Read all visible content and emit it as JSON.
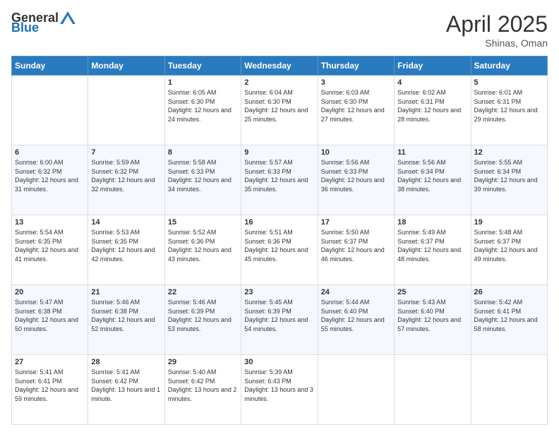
{
  "header": {
    "logo_general": "General",
    "logo_blue": "Blue",
    "title": "April 2025",
    "location": "Shinas, Oman"
  },
  "days_of_week": [
    "Sunday",
    "Monday",
    "Tuesday",
    "Wednesday",
    "Thursday",
    "Friday",
    "Saturday"
  ],
  "weeks": [
    [
      {
        "day": "",
        "sunrise": "",
        "sunset": "",
        "daylight": ""
      },
      {
        "day": "",
        "sunrise": "",
        "sunset": "",
        "daylight": ""
      },
      {
        "day": "1",
        "sunrise": "Sunrise: 6:05 AM",
        "sunset": "Sunset: 6:30 PM",
        "daylight": "Daylight: 12 hours and 24 minutes."
      },
      {
        "day": "2",
        "sunrise": "Sunrise: 6:04 AM",
        "sunset": "Sunset: 6:30 PM",
        "daylight": "Daylight: 12 hours and 25 minutes."
      },
      {
        "day": "3",
        "sunrise": "Sunrise: 6:03 AM",
        "sunset": "Sunset: 6:30 PM",
        "daylight": "Daylight: 12 hours and 27 minutes."
      },
      {
        "day": "4",
        "sunrise": "Sunrise: 6:02 AM",
        "sunset": "Sunset: 6:31 PM",
        "daylight": "Daylight: 12 hours and 28 minutes."
      },
      {
        "day": "5",
        "sunrise": "Sunrise: 6:01 AM",
        "sunset": "Sunset: 6:31 PM",
        "daylight": "Daylight: 12 hours and 29 minutes."
      }
    ],
    [
      {
        "day": "6",
        "sunrise": "Sunrise: 6:00 AM",
        "sunset": "Sunset: 6:32 PM",
        "daylight": "Daylight: 12 hours and 31 minutes."
      },
      {
        "day": "7",
        "sunrise": "Sunrise: 5:59 AM",
        "sunset": "Sunset: 6:32 PM",
        "daylight": "Daylight: 12 hours and 32 minutes."
      },
      {
        "day": "8",
        "sunrise": "Sunrise: 5:58 AM",
        "sunset": "Sunset: 6:33 PM",
        "daylight": "Daylight: 12 hours and 34 minutes."
      },
      {
        "day": "9",
        "sunrise": "Sunrise: 5:57 AM",
        "sunset": "Sunset: 6:33 PM",
        "daylight": "Daylight: 12 hours and 35 minutes."
      },
      {
        "day": "10",
        "sunrise": "Sunrise: 5:56 AM",
        "sunset": "Sunset: 6:33 PM",
        "daylight": "Daylight: 12 hours and 36 minutes."
      },
      {
        "day": "11",
        "sunrise": "Sunrise: 5:56 AM",
        "sunset": "Sunset: 6:34 PM",
        "daylight": "Daylight: 12 hours and 38 minutes."
      },
      {
        "day": "12",
        "sunrise": "Sunrise: 5:55 AM",
        "sunset": "Sunset: 6:34 PM",
        "daylight": "Daylight: 12 hours and 39 minutes."
      }
    ],
    [
      {
        "day": "13",
        "sunrise": "Sunrise: 5:54 AM",
        "sunset": "Sunset: 6:35 PM",
        "daylight": "Daylight: 12 hours and 41 minutes."
      },
      {
        "day": "14",
        "sunrise": "Sunrise: 5:53 AM",
        "sunset": "Sunset: 6:35 PM",
        "daylight": "Daylight: 12 hours and 42 minutes."
      },
      {
        "day": "15",
        "sunrise": "Sunrise: 5:52 AM",
        "sunset": "Sunset: 6:36 PM",
        "daylight": "Daylight: 12 hours and 43 minutes."
      },
      {
        "day": "16",
        "sunrise": "Sunrise: 5:51 AM",
        "sunset": "Sunset: 6:36 PM",
        "daylight": "Daylight: 12 hours and 45 minutes."
      },
      {
        "day": "17",
        "sunrise": "Sunrise: 5:50 AM",
        "sunset": "Sunset: 6:37 PM",
        "daylight": "Daylight: 12 hours and 46 minutes."
      },
      {
        "day": "18",
        "sunrise": "Sunrise: 5:49 AM",
        "sunset": "Sunset: 6:37 PM",
        "daylight": "Daylight: 12 hours and 48 minutes."
      },
      {
        "day": "19",
        "sunrise": "Sunrise: 5:48 AM",
        "sunset": "Sunset: 6:37 PM",
        "daylight": "Daylight: 12 hours and 49 minutes."
      }
    ],
    [
      {
        "day": "20",
        "sunrise": "Sunrise: 5:47 AM",
        "sunset": "Sunset: 6:38 PM",
        "daylight": "Daylight: 12 hours and 50 minutes."
      },
      {
        "day": "21",
        "sunrise": "Sunrise: 5:46 AM",
        "sunset": "Sunset: 6:38 PM",
        "daylight": "Daylight: 12 hours and 52 minutes."
      },
      {
        "day": "22",
        "sunrise": "Sunrise: 5:46 AM",
        "sunset": "Sunset: 6:39 PM",
        "daylight": "Daylight: 12 hours and 53 minutes."
      },
      {
        "day": "23",
        "sunrise": "Sunrise: 5:45 AM",
        "sunset": "Sunset: 6:39 PM",
        "daylight": "Daylight: 12 hours and 54 minutes."
      },
      {
        "day": "24",
        "sunrise": "Sunrise: 5:44 AM",
        "sunset": "Sunset: 6:40 PM",
        "daylight": "Daylight: 12 hours and 55 minutes."
      },
      {
        "day": "25",
        "sunrise": "Sunrise: 5:43 AM",
        "sunset": "Sunset: 6:40 PM",
        "daylight": "Daylight: 12 hours and 57 minutes."
      },
      {
        "day": "26",
        "sunrise": "Sunrise: 5:42 AM",
        "sunset": "Sunset: 6:41 PM",
        "daylight": "Daylight: 12 hours and 58 minutes."
      }
    ],
    [
      {
        "day": "27",
        "sunrise": "Sunrise: 5:41 AM",
        "sunset": "Sunset: 6:41 PM",
        "daylight": "Daylight: 12 hours and 59 minutes."
      },
      {
        "day": "28",
        "sunrise": "Sunrise: 5:41 AM",
        "sunset": "Sunset: 6:42 PM",
        "daylight": "Daylight: 13 hours and 1 minute."
      },
      {
        "day": "29",
        "sunrise": "Sunrise: 5:40 AM",
        "sunset": "Sunset: 6:42 PM",
        "daylight": "Daylight: 13 hours and 2 minutes."
      },
      {
        "day": "30",
        "sunrise": "Sunrise: 5:39 AM",
        "sunset": "Sunset: 6:43 PM",
        "daylight": "Daylight: 13 hours and 3 minutes."
      },
      {
        "day": "",
        "sunrise": "",
        "sunset": "",
        "daylight": ""
      },
      {
        "day": "",
        "sunrise": "",
        "sunset": "",
        "daylight": ""
      },
      {
        "day": "",
        "sunrise": "",
        "sunset": "",
        "daylight": ""
      }
    ]
  ]
}
